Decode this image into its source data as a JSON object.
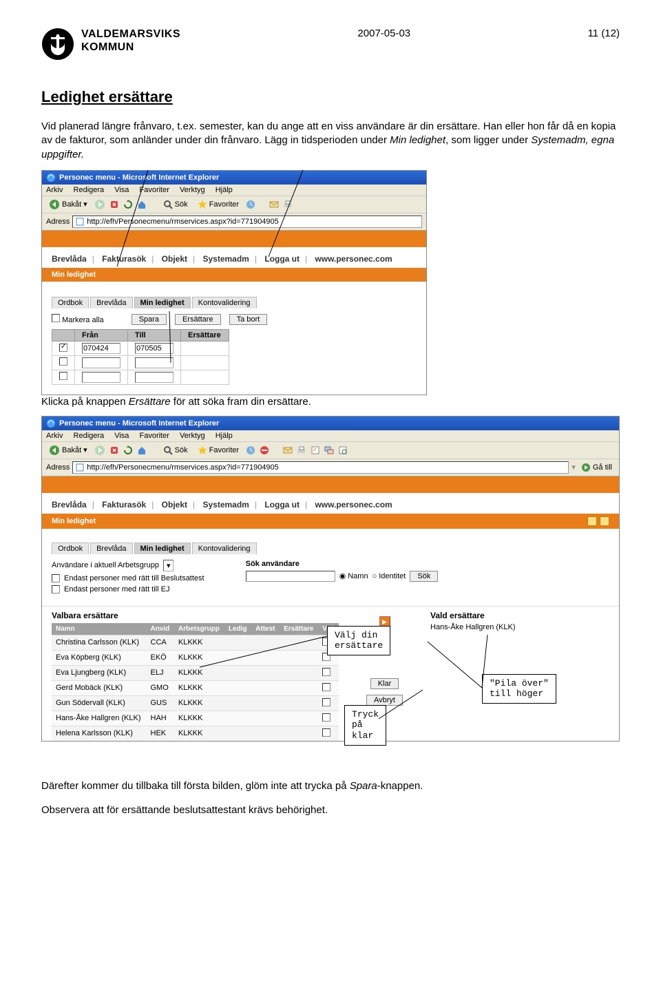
{
  "header": {
    "brand1": "VALDEMARSVIKS",
    "brand2": "KOMMUN",
    "date": "2007-05-03",
    "pagenum": "11 (12)"
  },
  "section_title": "Ledighet ersättare",
  "para1a": "Vid planerad längre frånvaro, t.ex. semester, kan du ange att en viss användare är din ersättare. Han eller hon får då en kopia av de fakturor, som anländer under din frånvaro. Lägg in tidsperioden under ",
  "para1b": "Min ledighet",
  "para1c": ", som ligger under ",
  "para1d": "Systemadm, egna uppgifter.",
  "caption2a": "Klicka på knappen ",
  "caption2b": "Ersättare",
  "caption2c": " för att söka fram din ersättare.",
  "footer1": "Därefter kommer du tillbaka till första bilden, glöm inte att trycka på ",
  "footer1b": "Spara",
  "footer1c": "-knappen.",
  "footer2": "Observera att för ersättande beslutsattestant krävs behörighet.",
  "ie": {
    "title": "Personec menu - Microsoft Internet Explorer",
    "menu": [
      "Arkiv",
      "Redigera",
      "Visa",
      "Favoriter",
      "Verktyg",
      "Hjälp"
    ],
    "back": "Bakåt",
    "search": "Sök",
    "fav": "Favoriter",
    "addr_label": "Adress",
    "url": "http://efh/Personecmenu/rmservices.aspx?id=771904905",
    "goto": "Gå till"
  },
  "appnav": [
    "Brevlåda",
    "Fakturasök",
    "Objekt",
    "Systemadm",
    "Logga ut",
    "www.personec.com"
  ],
  "sub": "Min ledighet",
  "tabs": [
    "Ordbok",
    "Brevlåda",
    "Min ledighet",
    "Kontovalidering"
  ],
  "s1": {
    "markera": "Markera alla",
    "btns": [
      "Spara",
      "Ersättare",
      "Ta bort"
    ],
    "headers": [
      "Från",
      "Till",
      "Ersättare"
    ],
    "row1": [
      "070424",
      "070505"
    ]
  },
  "s2": {
    "filter_label": "Användare i aktuell Arbetsgrupp",
    "chk1": "Endast personer med rätt till Beslutsattest",
    "chk2": "Endast personer med rätt till EJ",
    "search_label": "Sök användare",
    "radio1": "Namn",
    "radio2": "Identitet",
    "search_btn": "Sök",
    "left_title": "Valbara ersättare",
    "right_title": "Vald ersättare",
    "selected": "Hans-Åke Hallgren (KLK)",
    "headers": [
      "Namn",
      "Anvid",
      "Arbetsgrupp",
      "Ledig",
      "Attest",
      "Ersättare",
      "Valj"
    ],
    "rows": [
      {
        "n": "Christina Carlsson (KLK)",
        "a": "CCA",
        "g": "KLKKK"
      },
      {
        "n": "Eva Köpberg (KLK)",
        "a": "EKÖ",
        "g": "KLKKK"
      },
      {
        "n": "Eva Ljungberg (KLK)",
        "a": "ELJ",
        "g": "KLKKK"
      },
      {
        "n": "Gerd Mobäck (KLK)",
        "a": "GMO",
        "g": "KLKKK"
      },
      {
        "n": "Gun Södervall (KLK)",
        "a": "GUS",
        "g": "KLKKK"
      },
      {
        "n": "Hans-Åke Hallgren (KLK)",
        "a": "HAH",
        "g": "KLKKK"
      },
      {
        "n": "Helena Karlsson (KLK)",
        "a": "HEK",
        "g": "KLKKK"
      }
    ],
    "klar": "Klar",
    "avbryt": "Avbryt"
  },
  "callouts": {
    "valj": "Välj din\nersättare",
    "pila": "\"Pila över\"\ntill höger",
    "tryck": "Tryck\npå\nklar"
  }
}
